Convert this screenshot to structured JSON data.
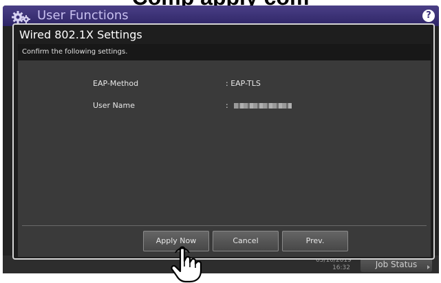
{
  "caption": {
    "text": "Comp                apply        com                        "
  },
  "app_bar": {
    "title": "User Functions",
    "help_label": "?"
  },
  "dialog": {
    "title": "Wired 802.1X Settings",
    "instruction": "Confirm the following settings.",
    "fields": [
      {
        "label": "EAP-Method",
        "value": ": EAP-TLS"
      },
      {
        "label": "User Name",
        "value": ":"
      }
    ],
    "buttons": {
      "apply": "Apply Now",
      "cancel": "Cancel",
      "prev": "Prev."
    }
  },
  "status_bar": {
    "date": "05/10/2019",
    "time": "16:32",
    "job_status": "Job Status"
  },
  "colors": {
    "accent": "#3a2f7a",
    "background": "#232323",
    "dialog_body": "#3a3a3a"
  }
}
